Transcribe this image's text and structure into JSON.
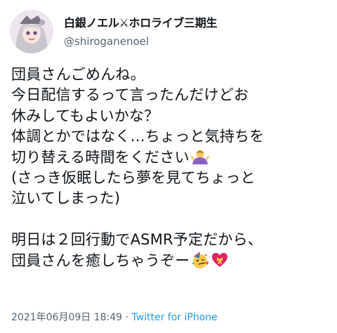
{
  "author": {
    "display_name": "白銀ノエル⚔ホロライブ三期生",
    "handle": "@shiroganenoel"
  },
  "tweet": {
    "lines": [
      "団員さんごめんね。",
      "今日配信するって言ったんだけどお",
      "休みしてもよいかな？",
      "体調とかではなく…ちょっと気持ちを",
      "切り替える時間をください",
      "(さっき仮眠したら夢を見てちょっと",
      "泣いてしまった)",
      "",
      "明日は２回行動でASMR予定だから、",
      "団員さんを癒しちゃうぞー"
    ]
  },
  "meta": {
    "timestamp": "2021年06月09日 18:49",
    "separator": " · ",
    "source": "Twitter for iPhone"
  },
  "icons": {
    "line5_end": "person-bowing-emoji",
    "line10_end": [
      "partying-face-emoji",
      "heart-with-ribbon-emoji"
    ]
  }
}
